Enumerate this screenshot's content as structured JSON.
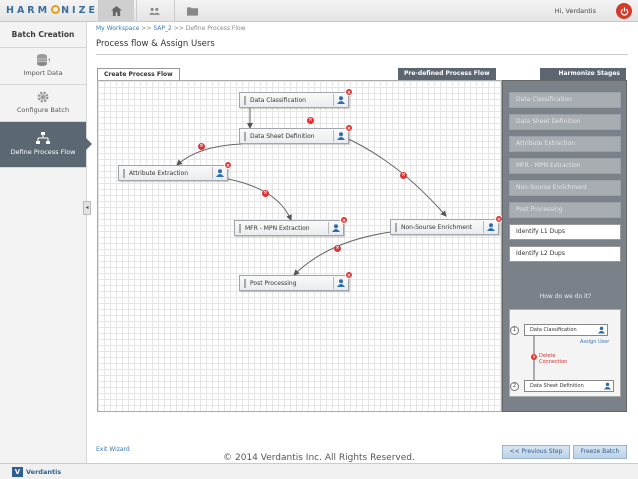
{
  "app": {
    "logo": "HARMONIZE",
    "greeting": "Hi, Verdantis"
  },
  "nav_tabs": [
    {
      "icon": "home-icon"
    },
    {
      "icon": "users-icon"
    },
    {
      "icon": "folder-icon"
    }
  ],
  "sidebar": {
    "title": "Batch Creation",
    "items": [
      {
        "label": "Import Data",
        "icon": "database-icon"
      },
      {
        "label": "Configure Batch",
        "icon": "gear-icon"
      },
      {
        "label": "Define Process Flow",
        "icon": "flow-icon"
      }
    ]
  },
  "breadcrumb": {
    "home": "My Workspace",
    "sep1": ">>",
    "batch": "SAP_2",
    "sep2": ">>",
    "current": "Define Process Flow"
  },
  "page_title": "Process flow & Assign Users",
  "tabs": {
    "create": "Create Process Flow",
    "predefined": "Pre-defined Process Flow",
    "stages": "Harmonize Stages"
  },
  "flow_nodes": [
    {
      "label": "Data Classification"
    },
    {
      "label": "Data Sheet Definition"
    },
    {
      "label": "Attribute Extraction"
    },
    {
      "label": "MFR - MPN Extraction"
    },
    {
      "label": "Non-Sourse Enrichment"
    },
    {
      "label": "Post Processing"
    }
  ],
  "stages": [
    {
      "label": "Data Classification",
      "enabled": false
    },
    {
      "label": "Data Sheet Definition",
      "enabled": false
    },
    {
      "label": "Attribute Extraction",
      "enabled": false
    },
    {
      "label": "MFR - MPN Extraction",
      "enabled": false
    },
    {
      "label": "Non-Sourse Enrichment",
      "enabled": false
    },
    {
      "label": "Post Processing",
      "enabled": false
    },
    {
      "label": "Identify L1 Dups",
      "enabled": true
    },
    {
      "label": "Identify L2 Dups",
      "enabled": true
    }
  ],
  "how_to": {
    "title": "How do we do it?",
    "step1": "1",
    "step2": "2",
    "node1": "Data Classification",
    "node2": "Data Sheet Definition",
    "assign_user": "Assign User",
    "delete_connection": "Delete Connection"
  },
  "footer": {
    "exit": "Exit Wizard",
    "prev": "<< Previous Step",
    "freeze": "Freeze Batch",
    "copyright": "© 2014 Verdantis Inc. All Rights Reserved.",
    "brand": "Verdantis"
  },
  "colors": {
    "accent": "#3a78b8",
    "delete": "#d33333",
    "panel": "#7a8189",
    "sidebar_active": "#5b6874"
  }
}
